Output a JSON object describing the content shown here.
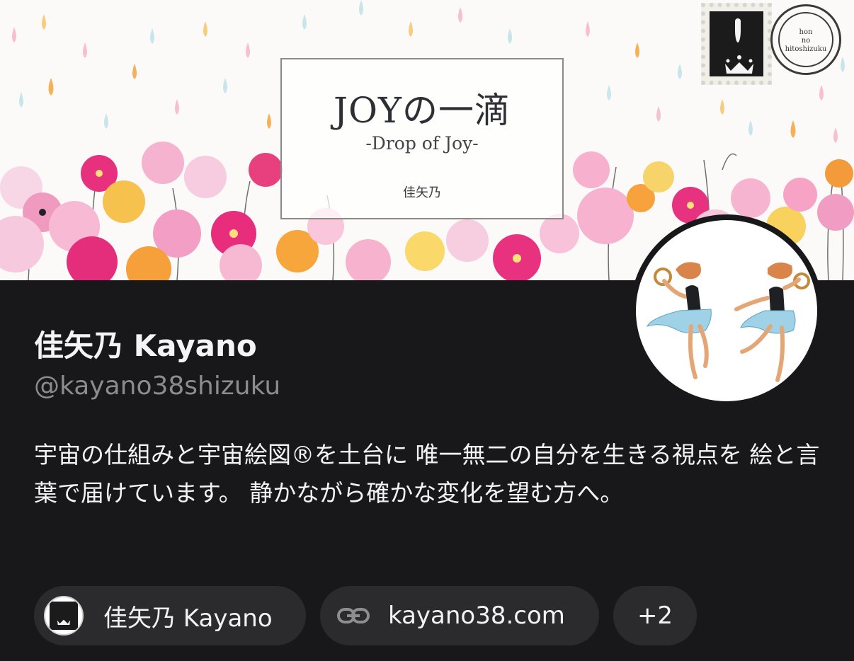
{
  "banner": {
    "title": "JOYの一滴",
    "subtitle": "-Drop of Joy-",
    "author": "佳矢乃",
    "postmark": [
      "hon",
      "no",
      "hitoshizuku"
    ]
  },
  "profile": {
    "display_name": "佳矢乃 Kayano",
    "handle": "@kayano38shizuku",
    "bio": "宇宙の仕組みと宇宙絵図®を土台に 唯一無二の自分を生きる視点を 絵と言葉で届けています。 静かながら確かな変化を望む方へ。"
  },
  "links": {
    "profile_chip": "佳矢乃 Kayano",
    "website": "kayano38.com",
    "more": "+2"
  },
  "colors": {
    "background": "#18181a",
    "chip": "#2b2b2d",
    "handle": "#8c8c90",
    "text": "#f3f3f3"
  },
  "icons": [
    "stamp-icon",
    "crown-icon",
    "link-icon",
    "dancers-illustration"
  ]
}
